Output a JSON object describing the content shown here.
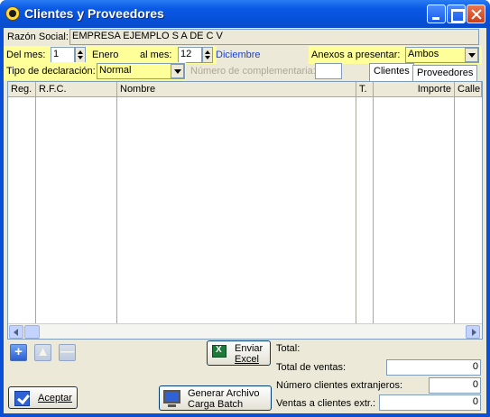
{
  "window": {
    "title": "Clientes y Proveedores"
  },
  "razon_social": {
    "label": "Razón Social:",
    "value": "EMPRESA EJEMPLO  S A  DE C V"
  },
  "periodo": {
    "del_mes_label": "Del mes:",
    "del_mes_value": "1",
    "del_mes_name": "Enero",
    "al_mes_label": "al mes:",
    "al_mes_value": "12",
    "al_mes_name": "Diciembre"
  },
  "anexos": {
    "label": "Anexos a presentar:",
    "value": "Ambos"
  },
  "tipo_declaracion": {
    "label": "Tipo de declaración:",
    "value": "Normal"
  },
  "complementaria": {
    "label": "Número de complementaria:",
    "value": ""
  },
  "tabs": [
    {
      "label": "Clientes"
    },
    {
      "label": "Proveedores"
    }
  ],
  "grid": {
    "columns": [
      "Reg.",
      "R.F.C.",
      "Nombre",
      "T.",
      "Importe",
      "Calle"
    ],
    "rows": []
  },
  "buttons": {
    "enviar_excel_line1": "Enviar",
    "enviar_excel_line2": "Excel",
    "generar_line1": "Generar Archivo",
    "generar_line2": "Carga Batch",
    "aceptar": "Aceptar"
  },
  "totals": {
    "total_label": "Total:",
    "total_ventas_label": "Total de ventas:",
    "total_ventas_value": "0",
    "num_extranjeros_label": "Número clientes extranjeros:",
    "num_extranjeros_value": "0",
    "ventas_extr_label": "Ventas a clientes extr.:",
    "ventas_extr_value": "0"
  },
  "icons": {
    "app": "app-icon",
    "add": "add-icon",
    "up": "move-up-icon",
    "delete": "delete-icon",
    "excel": "excel-icon",
    "check": "check-icon",
    "computer": "computer-icon"
  },
  "colors": {
    "titlebar": "#0a5ae6",
    "highlight_row": "#ffff99",
    "link_blue": "#1a3fd6"
  }
}
